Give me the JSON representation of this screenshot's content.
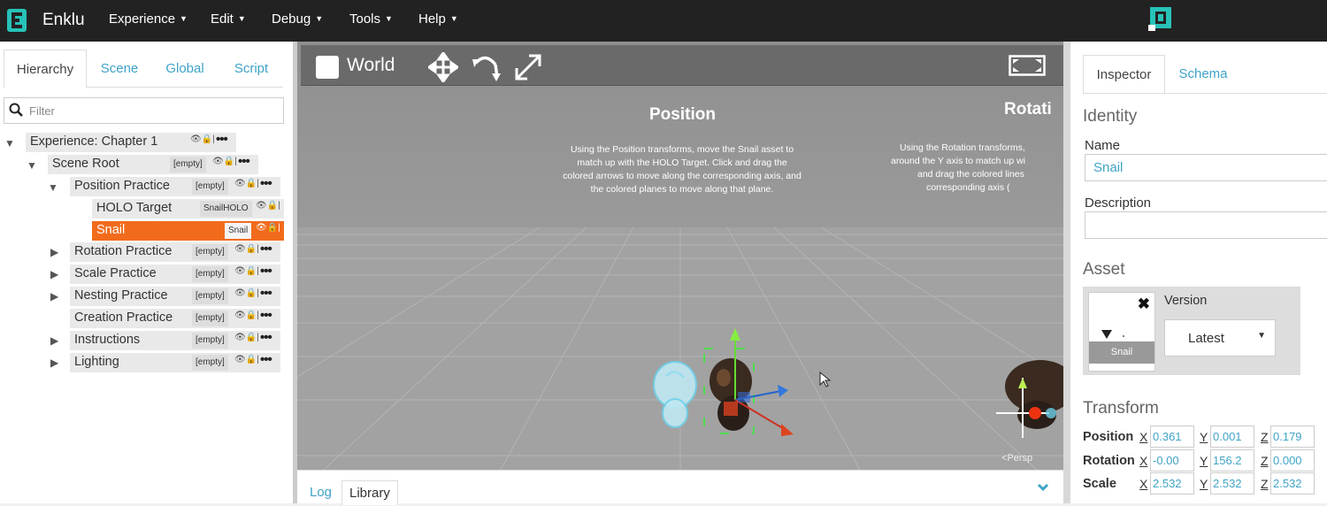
{
  "app": {
    "name": "Enklu"
  },
  "menu": [
    "Experience",
    "Edit",
    "Debug",
    "Tools",
    "Help"
  ],
  "left_tabs": [
    "Hierarchy",
    "Scene",
    "Global",
    "Script"
  ],
  "filter": {
    "placeholder": "Filter",
    "value": ""
  },
  "hierarchy": [
    {
      "label": "Experience: Chapter 1",
      "tag": "",
      "expander": "expanded",
      "selected": false
    },
    {
      "label": "Scene Root",
      "tag": "[empty]",
      "expander": "expanded",
      "selected": false
    },
    {
      "label": "Position Practice",
      "tag": "[empty]",
      "expander": "expanded",
      "selected": false
    },
    {
      "label": "HOLO Target",
      "tag": "SnailHOLO",
      "expander": "none",
      "selected": false
    },
    {
      "label": "Snail",
      "tag": "Snail",
      "expander": "none",
      "selected": true
    },
    {
      "label": "Rotation Practice",
      "tag": "[empty]",
      "expander": "collapsed",
      "selected": false
    },
    {
      "label": "Scale Practice",
      "tag": "[empty]",
      "expander": "collapsed",
      "selected": false
    },
    {
      "label": "Nesting Practice",
      "tag": "[empty]",
      "expander": "collapsed",
      "selected": false
    },
    {
      "label": "Creation Practice",
      "tag": "[empty]",
      "expander": "none",
      "selected": false
    },
    {
      "label": "Instructions",
      "tag": "[empty]",
      "expander": "collapsed",
      "selected": false
    },
    {
      "label": "Lighting",
      "tag": "[empty]",
      "expander": "collapsed",
      "selected": false
    }
  ],
  "row_actions": {
    "more": "•••"
  },
  "viewport": {
    "world_label": "World",
    "tools": [
      "move-tool-icon",
      "rotate-tool-icon",
      "scale-tool-icon"
    ],
    "persp_label": "Persp",
    "panels": [
      {
        "title": "Position",
        "lines": [
          "Using the Position transforms, move the Snail asset to",
          "match up with the HOLO Target. Click and drag the",
          "colored arrows to move along the corresponding axis, and",
          "the colored planes to move along that plane."
        ]
      },
      {
        "title": "Rotati",
        "lines": [
          "Using the Rotation transforms,",
          "around the Y axis to match up wi",
          "and drag the colored lines",
          "corresponding axis ("
        ]
      }
    ]
  },
  "console_tabs": [
    "Log",
    "Library"
  ],
  "right_tabs": [
    "Inspector",
    "Schema"
  ],
  "inspector": {
    "identity_title": "Identity",
    "name_label": "Name",
    "name_value": "Snail",
    "description_label": "Description",
    "description_value": "",
    "asset_title": "Asset",
    "asset_name": "Snail",
    "version_label": "Version",
    "version_value": "Latest",
    "transform_title": "Transform",
    "transform": [
      {
        "label": "Position",
        "x": "0.361",
        "y": "0.001",
        "z": "0.179"
      },
      {
        "label": "Rotation",
        "x": "-0.00",
        "y": "156.2",
        "z": "0.000"
      },
      {
        "label": "Scale",
        "x": "2.532",
        "y": "2.532",
        "z": "2.532"
      }
    ],
    "axes": [
      "X",
      "Y",
      "Z"
    ]
  },
  "colors": {
    "accent": "#3fa3c7",
    "selected": "#f26b1d",
    "topbar": "#222222",
    "logo": "#27c2b8"
  }
}
